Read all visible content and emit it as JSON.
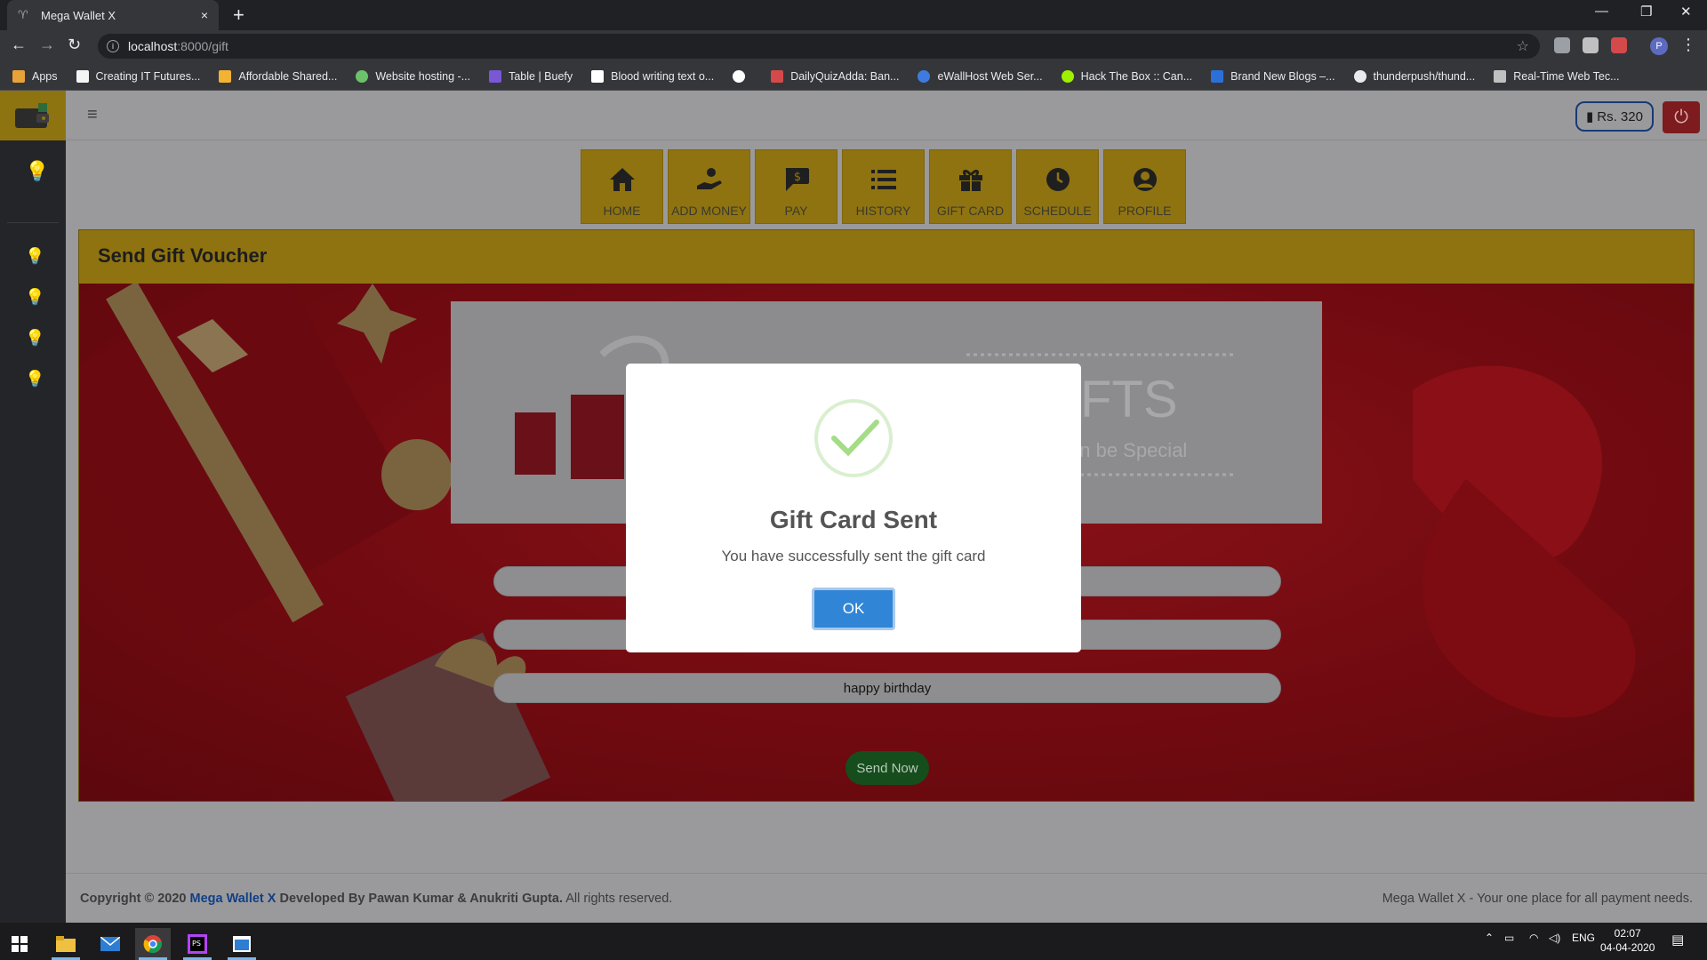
{
  "browser": {
    "tab_title": "Mega Wallet X",
    "tab_close": "×",
    "new_tab": "+",
    "url_host": "localhost",
    "url_path": ":8000/gift",
    "profile_initial": "P",
    "window_controls": [
      "—",
      "❐",
      "✕"
    ]
  },
  "bookmarks": [
    {
      "label": "Apps",
      "color": "#e8a23a"
    },
    {
      "label": "Creating IT Futures...",
      "color": "#f4f4f4"
    },
    {
      "label": "Affordable Shared...",
      "color": "#f2b233"
    },
    {
      "label": "Website hosting -...",
      "color": "#6bc26b"
    },
    {
      "label": "Table | Buefy",
      "color": "#7957d5"
    },
    {
      "label": "Blood writing text o...",
      "color": "#ffffff"
    },
    {
      "label": "",
      "color": "#ffffff"
    },
    {
      "label": "DailyQuizAdda: Ban...",
      "color": "#d44a4a"
    },
    {
      "label": "eWallHost Web Ser...",
      "color": "#3d7be0"
    },
    {
      "label": "Hack The Box :: Can...",
      "color": "#9fef00"
    },
    {
      "label": "Brand New Blogs –...",
      "color": "#2d6fd8"
    },
    {
      "label": "thunderpush/thund...",
      "color": "#e8eaed"
    },
    {
      "label": "Real-Time Web Tec...",
      "color": "#c0c0c0"
    }
  ],
  "topbar": {
    "balance": "Rs. 320"
  },
  "nav": [
    {
      "label": "HOME",
      "icon": "home-icon",
      "glyph": "⌂"
    },
    {
      "label": "ADD MONEY",
      "icon": "hand-money-icon",
      "glyph": "🤲"
    },
    {
      "label": "PAY",
      "icon": "dollar-icon",
      "glyph": "$"
    },
    {
      "label": "HISTORY",
      "icon": "list-icon",
      "glyph": "☰"
    },
    {
      "label": "GIFT CARD",
      "icon": "gift-icon",
      "glyph": "🎁"
    },
    {
      "label": "SCHEDULE",
      "icon": "clock-icon",
      "glyph": "🕓"
    },
    {
      "label": "PROFILE",
      "icon": "user-icon",
      "glyph": "👤"
    }
  ],
  "card": {
    "title": "Send Gift Voucher",
    "message_value": "happy birthday",
    "send_button": "Send Now"
  },
  "modal": {
    "title": "Gift Card Sent",
    "text": "You have successfully sent the gift card",
    "ok_button": "OK"
  },
  "footer": {
    "copyright_prefix": "Copyright © 2020 ",
    "brand": "Mega Wallet X",
    "developed_by": " Developed By Pawan Kumar & Anukriti Gupta.",
    "rights": " All rights reserved.",
    "tagline": "Mega Wallet X - Your one place for all payment needs."
  },
  "taskbar": {
    "language": "ENG",
    "time": "02:07",
    "date": "04-04-2020"
  },
  "colors": {
    "accent_gold": "#8f7311",
    "danger": "#7d1b1f",
    "success": "#164d1d",
    "ok_blue": "#3085d6"
  }
}
